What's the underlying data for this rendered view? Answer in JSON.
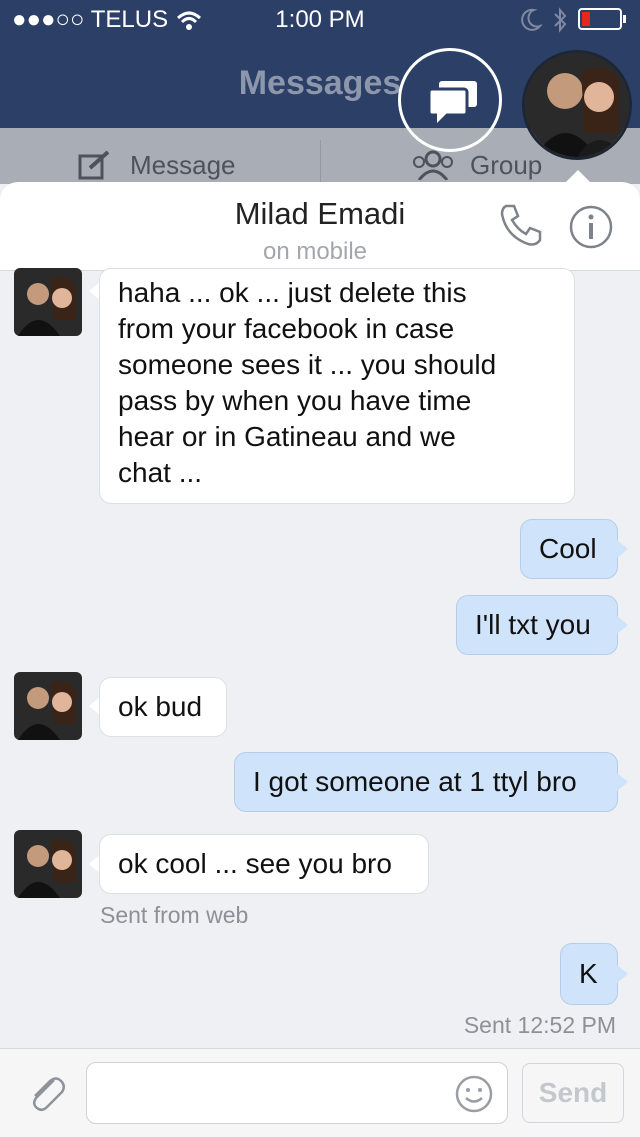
{
  "status_bar": {
    "carrier": "●●●○○ TELUS",
    "time": "1:00 PM"
  },
  "nav": {
    "title": "Messages"
  },
  "subnav": {
    "message_label": "Message",
    "group_label": "Group"
  },
  "conversation": {
    "contact_name": "Milad Emadi",
    "contact_status": "on mobile"
  },
  "messages": [
    {
      "direction": "incoming",
      "lines": [
        "haha ... ok ... just delete this",
        "from your facebook in case",
        "someone sees it ... you should",
        "pass by when you have time",
        "hear or in Gatineau and we",
        "chat ..."
      ]
    },
    {
      "direction": "outgoing",
      "text": "Cool"
    },
    {
      "direction": "outgoing",
      "text": "I'll txt you"
    },
    {
      "direction": "incoming",
      "text": "ok bud"
    },
    {
      "direction": "outgoing",
      "text": "I got someone at 1 ttyl bro"
    },
    {
      "direction": "incoming",
      "text": "ok cool ... see you bro",
      "meta": "Sent from web"
    },
    {
      "direction": "outgoing",
      "text": "K",
      "meta": "Sent 12:52 PM"
    }
  ],
  "compose": {
    "placeholder": "",
    "send_label": "Send"
  },
  "colors": {
    "nav_bg": "#2c3f66",
    "outgoing_bubble": "#cfe3fb",
    "incoming_bubble": "#ffffff",
    "battery_low": "#e8261f"
  },
  "icons": [
    "wifi-icon",
    "moon-icon",
    "bluetooth-icon",
    "battery-icon",
    "chat-heads-icon",
    "compose-icon",
    "group-icon",
    "phone-icon",
    "info-icon",
    "attachment-icon",
    "emoji-icon"
  ]
}
